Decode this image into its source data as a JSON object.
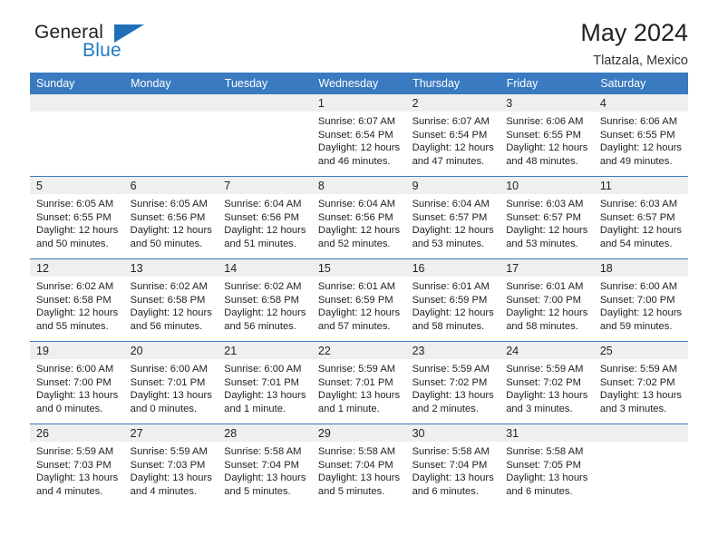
{
  "brand": {
    "name_part1": "General",
    "name_part2": "Blue",
    "triangle_color": "#1d70b8",
    "blue_color": "#1f7ac4"
  },
  "header": {
    "title": "May 2024",
    "subtitle": "Tlatzala, Mexico",
    "header_bg": "#3a7ac0",
    "header_text_color": "#ffffff",
    "daynum_bg": "#efefef"
  },
  "weekdays": [
    "Sunday",
    "Monday",
    "Tuesday",
    "Wednesday",
    "Thursday",
    "Friday",
    "Saturday"
  ],
  "weeks": [
    [
      {
        "day": "",
        "sunrise": "",
        "sunset": "",
        "daylight1": "",
        "daylight2": "",
        "empty": true
      },
      {
        "day": "",
        "sunrise": "",
        "sunset": "",
        "daylight1": "",
        "daylight2": "",
        "empty": true
      },
      {
        "day": "",
        "sunrise": "",
        "sunset": "",
        "daylight1": "",
        "daylight2": "",
        "empty": true
      },
      {
        "day": "1",
        "sunrise": "Sunrise: 6:07 AM",
        "sunset": "Sunset: 6:54 PM",
        "daylight1": "Daylight: 12 hours",
        "daylight2": "and 46 minutes."
      },
      {
        "day": "2",
        "sunrise": "Sunrise: 6:07 AM",
        "sunset": "Sunset: 6:54 PM",
        "daylight1": "Daylight: 12 hours",
        "daylight2": "and 47 minutes."
      },
      {
        "day": "3",
        "sunrise": "Sunrise: 6:06 AM",
        "sunset": "Sunset: 6:55 PM",
        "daylight1": "Daylight: 12 hours",
        "daylight2": "and 48 minutes."
      },
      {
        "day": "4",
        "sunrise": "Sunrise: 6:06 AM",
        "sunset": "Sunset: 6:55 PM",
        "daylight1": "Daylight: 12 hours",
        "daylight2": "and 49 minutes."
      }
    ],
    [
      {
        "day": "5",
        "sunrise": "Sunrise: 6:05 AM",
        "sunset": "Sunset: 6:55 PM",
        "daylight1": "Daylight: 12 hours",
        "daylight2": "and 50 minutes."
      },
      {
        "day": "6",
        "sunrise": "Sunrise: 6:05 AM",
        "sunset": "Sunset: 6:56 PM",
        "daylight1": "Daylight: 12 hours",
        "daylight2": "and 50 minutes."
      },
      {
        "day": "7",
        "sunrise": "Sunrise: 6:04 AM",
        "sunset": "Sunset: 6:56 PM",
        "daylight1": "Daylight: 12 hours",
        "daylight2": "and 51 minutes."
      },
      {
        "day": "8",
        "sunrise": "Sunrise: 6:04 AM",
        "sunset": "Sunset: 6:56 PM",
        "daylight1": "Daylight: 12 hours",
        "daylight2": "and 52 minutes."
      },
      {
        "day": "9",
        "sunrise": "Sunrise: 6:04 AM",
        "sunset": "Sunset: 6:57 PM",
        "daylight1": "Daylight: 12 hours",
        "daylight2": "and 53 minutes."
      },
      {
        "day": "10",
        "sunrise": "Sunrise: 6:03 AM",
        "sunset": "Sunset: 6:57 PM",
        "daylight1": "Daylight: 12 hours",
        "daylight2": "and 53 minutes."
      },
      {
        "day": "11",
        "sunrise": "Sunrise: 6:03 AM",
        "sunset": "Sunset: 6:57 PM",
        "daylight1": "Daylight: 12 hours",
        "daylight2": "and 54 minutes."
      }
    ],
    [
      {
        "day": "12",
        "sunrise": "Sunrise: 6:02 AM",
        "sunset": "Sunset: 6:58 PM",
        "daylight1": "Daylight: 12 hours",
        "daylight2": "and 55 minutes."
      },
      {
        "day": "13",
        "sunrise": "Sunrise: 6:02 AM",
        "sunset": "Sunset: 6:58 PM",
        "daylight1": "Daylight: 12 hours",
        "daylight2": "and 56 minutes."
      },
      {
        "day": "14",
        "sunrise": "Sunrise: 6:02 AM",
        "sunset": "Sunset: 6:58 PM",
        "daylight1": "Daylight: 12 hours",
        "daylight2": "and 56 minutes."
      },
      {
        "day": "15",
        "sunrise": "Sunrise: 6:01 AM",
        "sunset": "Sunset: 6:59 PM",
        "daylight1": "Daylight: 12 hours",
        "daylight2": "and 57 minutes."
      },
      {
        "day": "16",
        "sunrise": "Sunrise: 6:01 AM",
        "sunset": "Sunset: 6:59 PM",
        "daylight1": "Daylight: 12 hours",
        "daylight2": "and 58 minutes."
      },
      {
        "day": "17",
        "sunrise": "Sunrise: 6:01 AM",
        "sunset": "Sunset: 7:00 PM",
        "daylight1": "Daylight: 12 hours",
        "daylight2": "and 58 minutes."
      },
      {
        "day": "18",
        "sunrise": "Sunrise: 6:00 AM",
        "sunset": "Sunset: 7:00 PM",
        "daylight1": "Daylight: 12 hours",
        "daylight2": "and 59 minutes."
      }
    ],
    [
      {
        "day": "19",
        "sunrise": "Sunrise: 6:00 AM",
        "sunset": "Sunset: 7:00 PM",
        "daylight1": "Daylight: 13 hours",
        "daylight2": "and 0 minutes."
      },
      {
        "day": "20",
        "sunrise": "Sunrise: 6:00 AM",
        "sunset": "Sunset: 7:01 PM",
        "daylight1": "Daylight: 13 hours",
        "daylight2": "and 0 minutes."
      },
      {
        "day": "21",
        "sunrise": "Sunrise: 6:00 AM",
        "sunset": "Sunset: 7:01 PM",
        "daylight1": "Daylight: 13 hours",
        "daylight2": "and 1 minute."
      },
      {
        "day": "22",
        "sunrise": "Sunrise: 5:59 AM",
        "sunset": "Sunset: 7:01 PM",
        "daylight1": "Daylight: 13 hours",
        "daylight2": "and 1 minute."
      },
      {
        "day": "23",
        "sunrise": "Sunrise: 5:59 AM",
        "sunset": "Sunset: 7:02 PM",
        "daylight1": "Daylight: 13 hours",
        "daylight2": "and 2 minutes."
      },
      {
        "day": "24",
        "sunrise": "Sunrise: 5:59 AM",
        "sunset": "Sunset: 7:02 PM",
        "daylight1": "Daylight: 13 hours",
        "daylight2": "and 3 minutes."
      },
      {
        "day": "25",
        "sunrise": "Sunrise: 5:59 AM",
        "sunset": "Sunset: 7:02 PM",
        "daylight1": "Daylight: 13 hours",
        "daylight2": "and 3 minutes."
      }
    ],
    [
      {
        "day": "26",
        "sunrise": "Sunrise: 5:59 AM",
        "sunset": "Sunset: 7:03 PM",
        "daylight1": "Daylight: 13 hours",
        "daylight2": "and 4 minutes."
      },
      {
        "day": "27",
        "sunrise": "Sunrise: 5:59 AM",
        "sunset": "Sunset: 7:03 PM",
        "daylight1": "Daylight: 13 hours",
        "daylight2": "and 4 minutes."
      },
      {
        "day": "28",
        "sunrise": "Sunrise: 5:58 AM",
        "sunset": "Sunset: 7:04 PM",
        "daylight1": "Daylight: 13 hours",
        "daylight2": "and 5 minutes."
      },
      {
        "day": "29",
        "sunrise": "Sunrise: 5:58 AM",
        "sunset": "Sunset: 7:04 PM",
        "daylight1": "Daylight: 13 hours",
        "daylight2": "and 5 minutes."
      },
      {
        "day": "30",
        "sunrise": "Sunrise: 5:58 AM",
        "sunset": "Sunset: 7:04 PM",
        "daylight1": "Daylight: 13 hours",
        "daylight2": "and 6 minutes."
      },
      {
        "day": "31",
        "sunrise": "Sunrise: 5:58 AM",
        "sunset": "Sunset: 7:05 PM",
        "daylight1": "Daylight: 13 hours",
        "daylight2": "and 6 minutes."
      },
      {
        "day": "",
        "sunrise": "",
        "sunset": "",
        "daylight1": "",
        "daylight2": "",
        "empty": true
      }
    ]
  ]
}
